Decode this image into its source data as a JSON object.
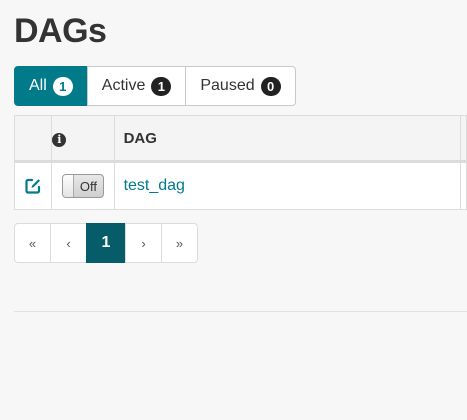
{
  "page": {
    "title": "DAGs"
  },
  "filters": [
    {
      "label": "All",
      "count": "1",
      "active": true
    },
    {
      "label": "Active",
      "count": "1",
      "active": false
    },
    {
      "label": "Paused",
      "count": "0",
      "active": false
    }
  ],
  "table": {
    "columns": {
      "info_icon": "info-icon",
      "dag": "DAG"
    },
    "rows": [
      {
        "edit_icon": "edit-icon",
        "toggle_state": "Off",
        "dag_id": "test_dag"
      }
    ]
  },
  "pagination": {
    "first": "«",
    "prev": "‹",
    "current": "1",
    "next": "›",
    "last": "»"
  },
  "colors": {
    "accent": "#017a8a",
    "pagination_active": "#065d69"
  }
}
